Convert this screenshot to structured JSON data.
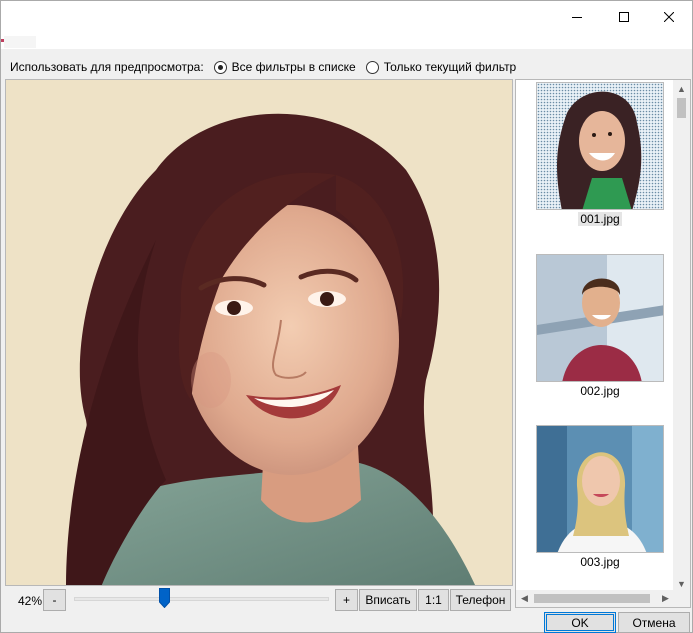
{
  "window": {
    "minimize_icon": "minimize-icon",
    "maximize_icon": "maximize-icon",
    "close_icon": "close-icon"
  },
  "preview_options": {
    "label": "Использовать для предпросмотра:",
    "options": [
      {
        "label": "Все фильтры в списке",
        "checked": true
      },
      {
        "label": "Только текущий фильтр",
        "checked": false
      }
    ]
  },
  "thumbnails": [
    {
      "caption": "001.jpg",
      "selected": true
    },
    {
      "caption": "002.jpg",
      "selected": false
    },
    {
      "caption": "003.jpg",
      "selected": false
    }
  ],
  "zoom": {
    "value_label": "42%",
    "minus_label": "-",
    "plus_label": "+",
    "fit_label": "Вписать",
    "one_to_one_label": "1:1",
    "phone_label": "Телефон",
    "slider_fraction": 0.36
  },
  "dialog": {
    "ok_label": "OK",
    "cancel_label": "Отмена"
  },
  "colors": {
    "accent": "#0078d7",
    "slider_thumb": "#0063c8",
    "preview_tone": "#eee2c6"
  }
}
